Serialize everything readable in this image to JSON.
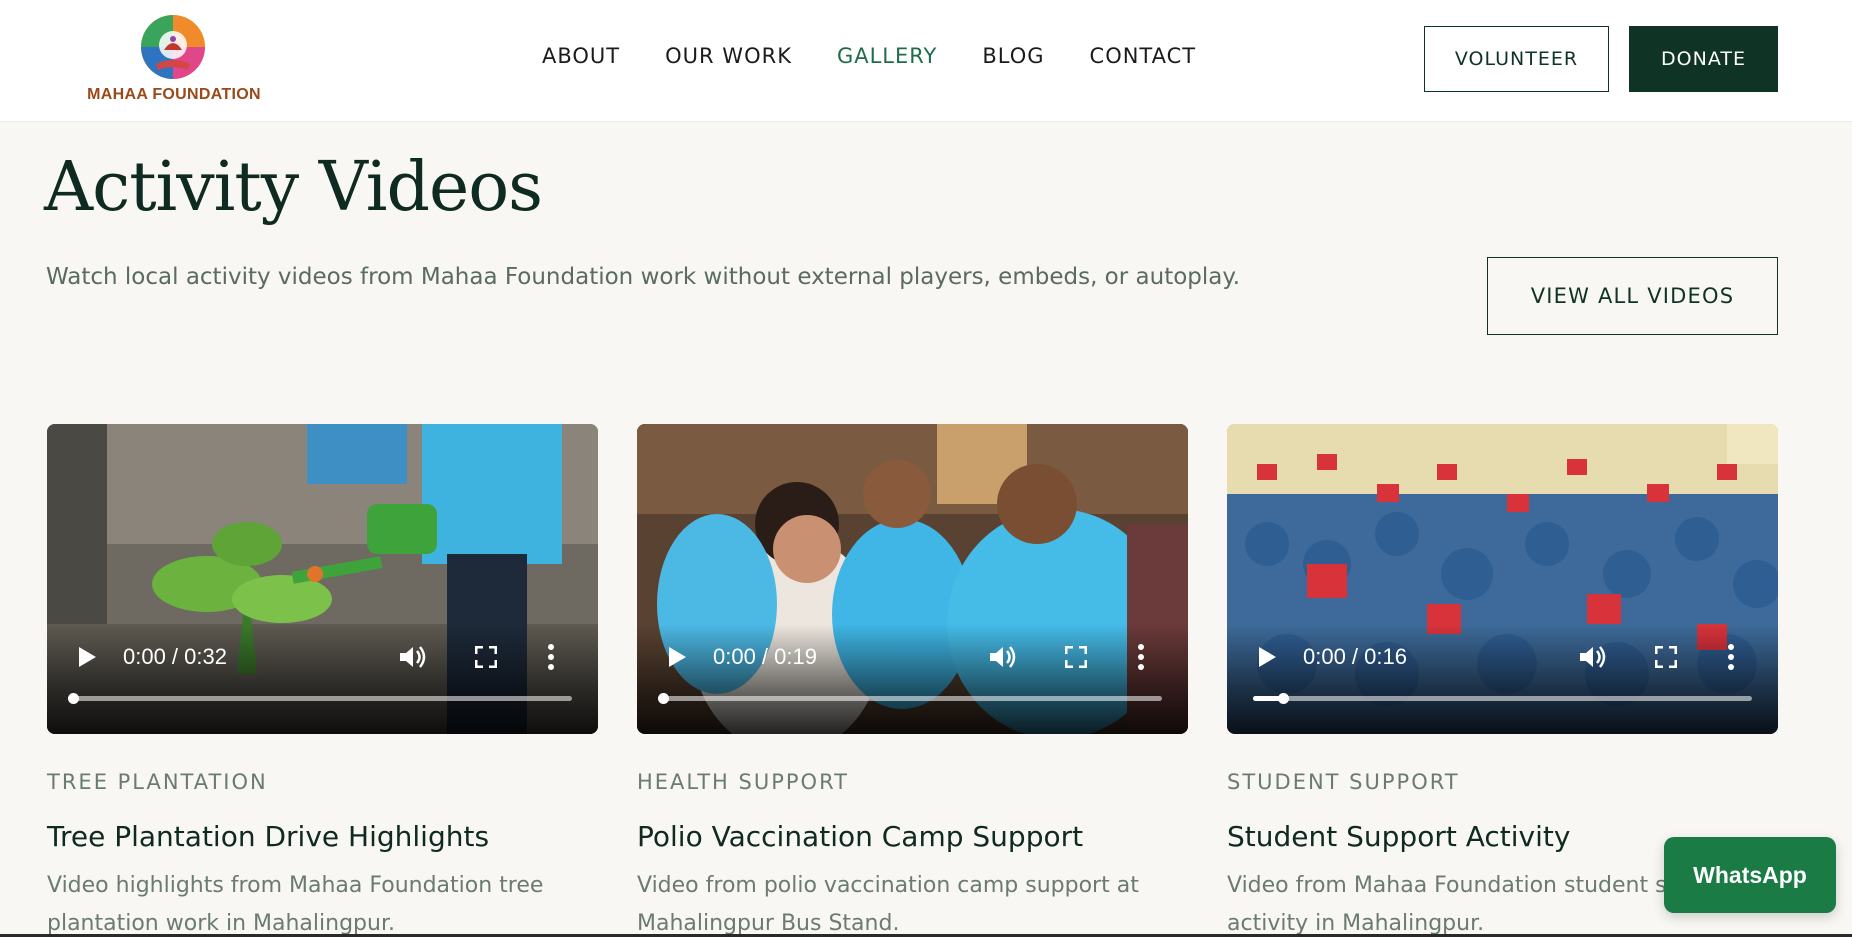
{
  "header": {
    "logo_text": "MAHAA FOUNDATION",
    "nav": [
      {
        "label": "ABOUT",
        "active": false
      },
      {
        "label": "OUR WORK",
        "active": false
      },
      {
        "label": "GALLERY",
        "active": true
      },
      {
        "label": "BLOG",
        "active": false
      },
      {
        "label": "CONTACT",
        "active": false
      }
    ],
    "volunteer_label": "VOLUNTEER",
    "donate_label": "DONATE"
  },
  "section": {
    "title": "Activity Videos",
    "description": "Watch local activity videos from Mahaa Foundation work without external players, embeds, or autoplay.",
    "view_all_label": "VIEW ALL VIDEOS"
  },
  "videos": [
    {
      "category": "TREE PLANTATION",
      "title": "Tree Plantation Drive Highlights",
      "description": "Video highlights from Mahaa Foundation tree plantation work in Mahalingpur.",
      "time": "0:00 / 0:32",
      "progress": 0.0
    },
    {
      "category": "HEALTH SUPPORT",
      "title": "Polio Vaccination Camp Support",
      "description": "Video from polio vaccination camp support at Mahalingpur Bus Stand.",
      "time": "0:00 / 0:19",
      "progress": 0.0
    },
    {
      "category": "STUDENT SUPPORT",
      "title": "Student Support Activity",
      "description": "Video from Mahaa Foundation student support activity in Mahalingpur.",
      "time": "0:00 / 0:16",
      "progress": 0.06
    }
  ],
  "whatsapp_label": "WhatsApp",
  "colors": {
    "brand_dark": "#0f3325",
    "nav_active": "#1f6b4c",
    "whatsapp": "#1a7b45",
    "page_bg": "#f8f7f3"
  },
  "icons": {
    "play": "play-icon",
    "volume": "volume-icon",
    "fullscreen": "fullscreen-icon",
    "more": "more-vertical-icon"
  }
}
